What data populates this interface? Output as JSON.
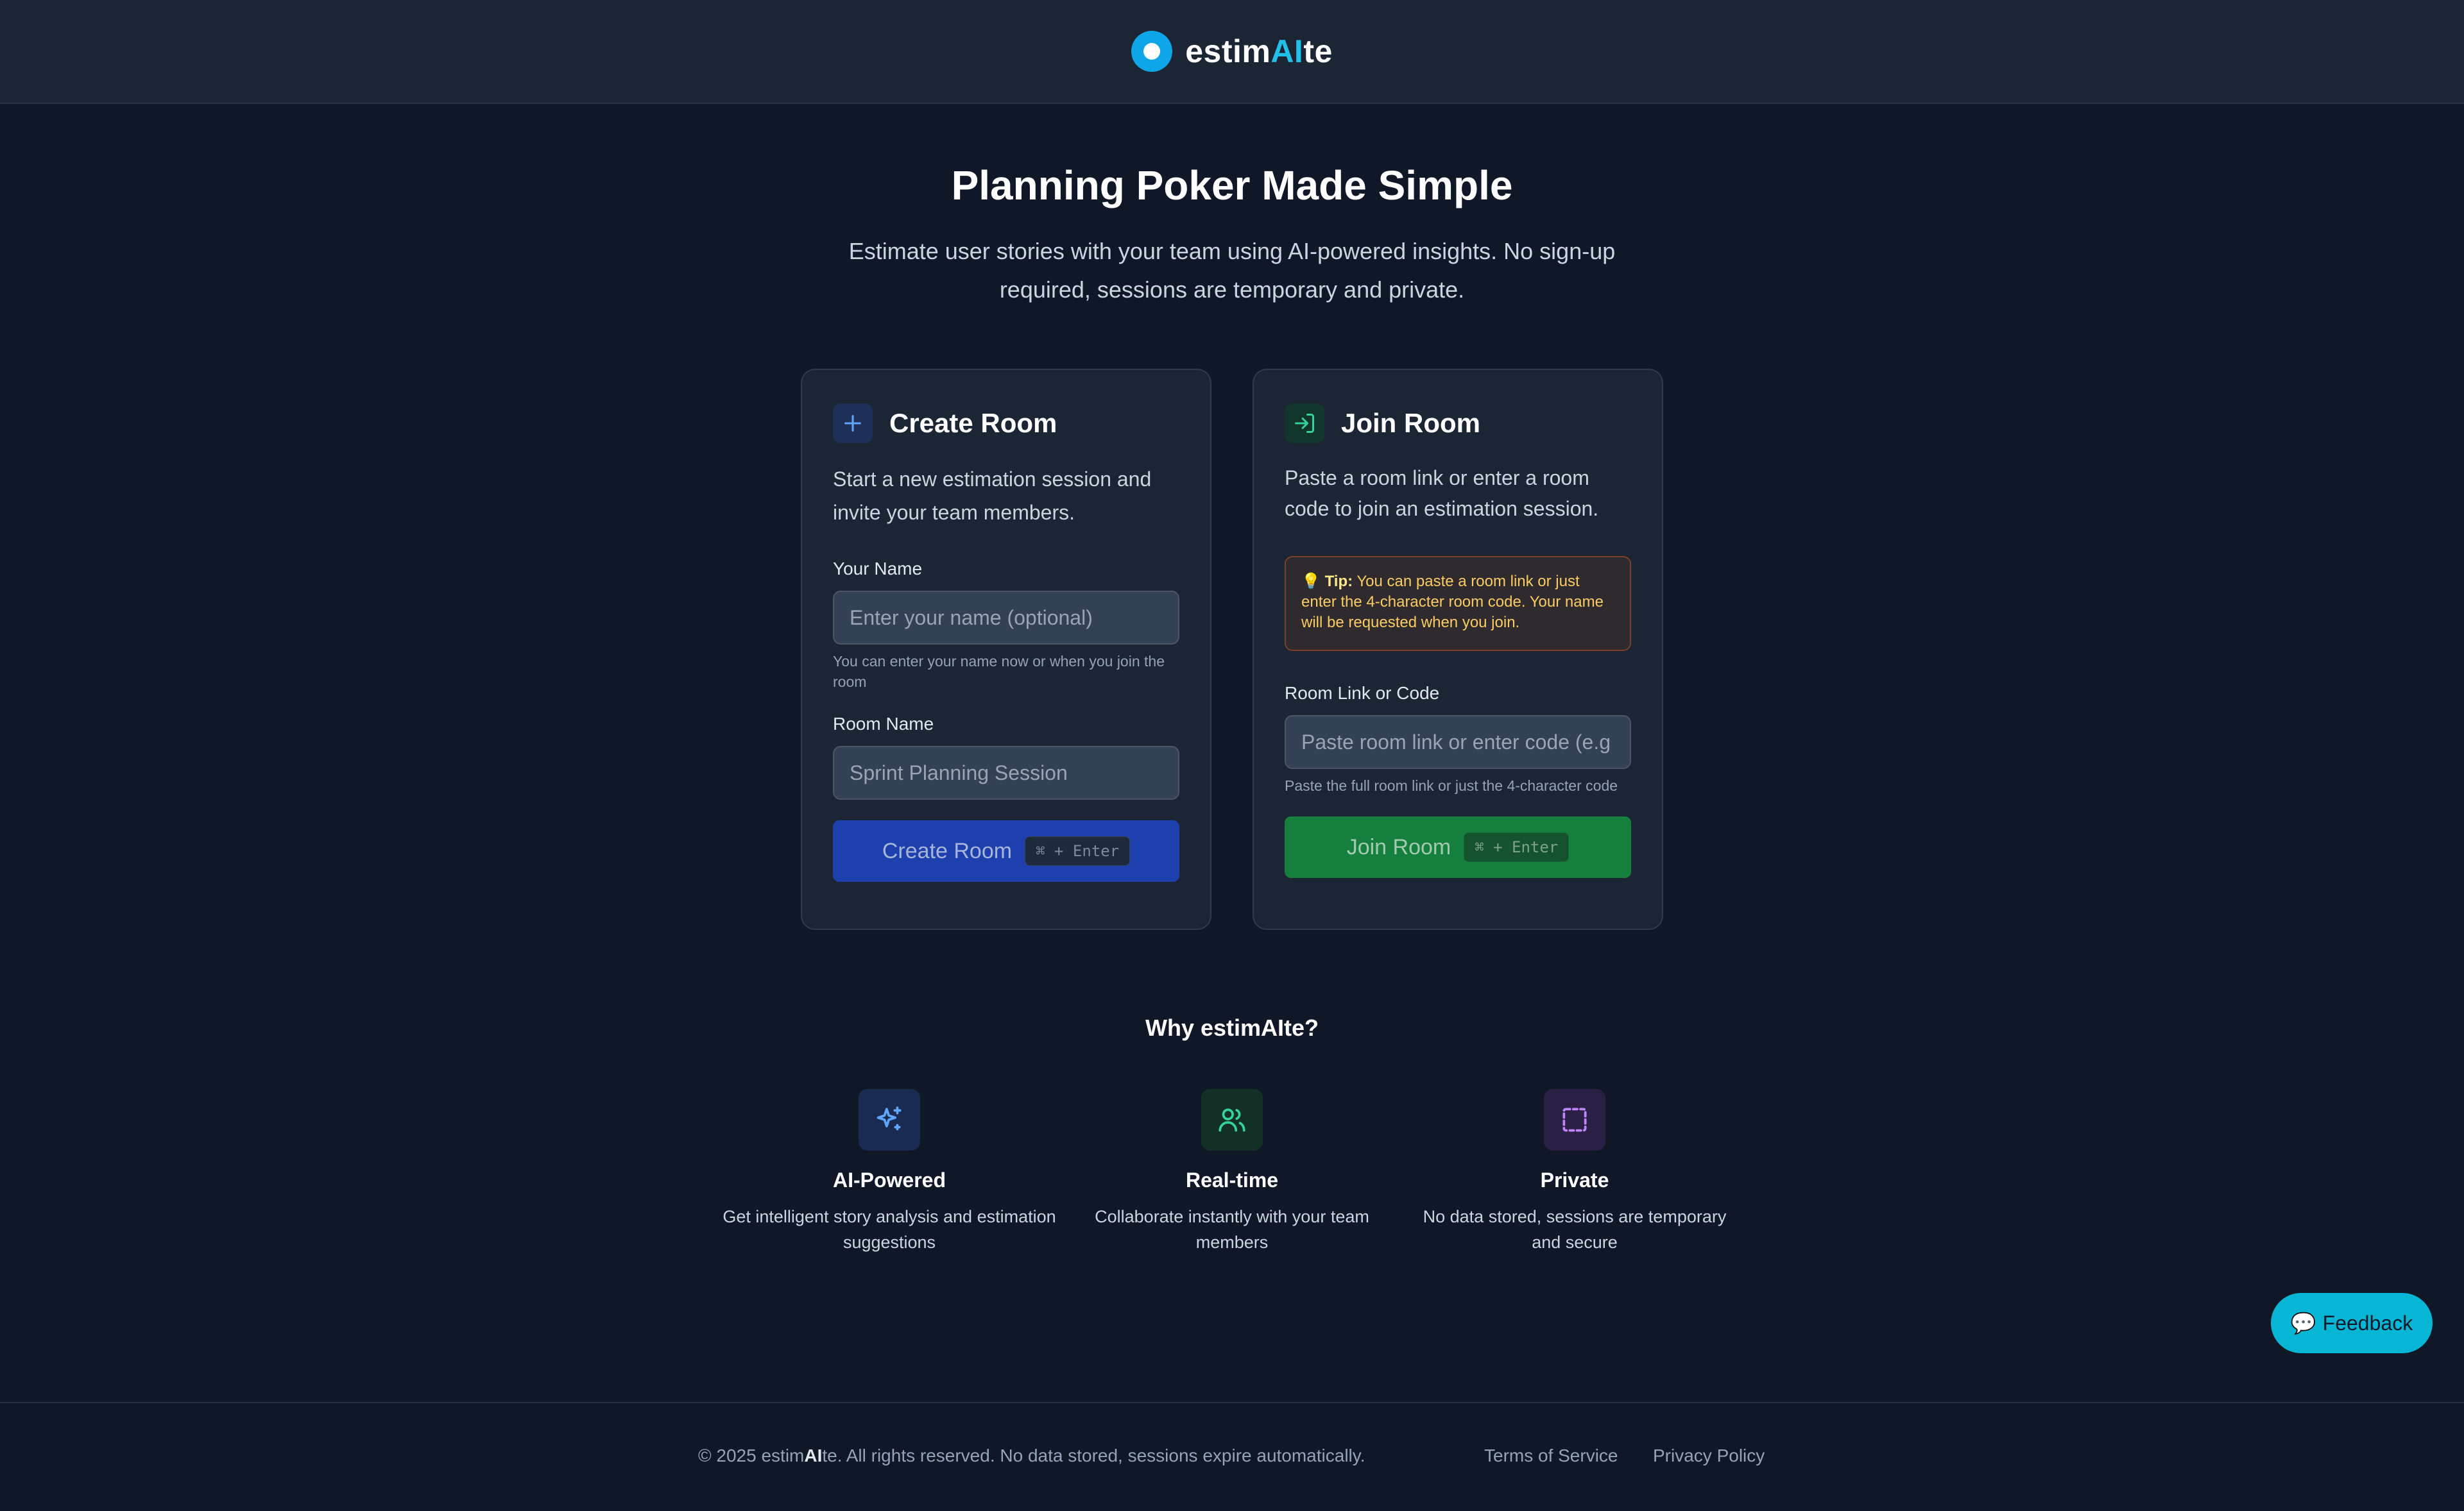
{
  "header": {
    "brand_prefix": "estim",
    "brand_accent": "AI",
    "brand_suffix": "te",
    "accent_color": "#22c0e8"
  },
  "hero": {
    "title": "Planning Poker Made Simple",
    "subtitle": "Estimate user stories with your team using AI-powered insights. No sign-up required, sessions are temporary and private."
  },
  "create_room": {
    "icon": "plus-icon",
    "title": "Create Room",
    "description": "Start a new estimation session and invite your team members.",
    "name_label": "Your Name",
    "name_value": "",
    "name_placeholder": "Enter your name (optional)",
    "name_hint": "You can enter your name now or when you join the room",
    "room_label": "Room Name",
    "room_value": "",
    "room_placeholder": "Sprint Planning Session",
    "button_label": "Create Room",
    "shortcut": "⌘ + Enter",
    "button_color": "#1e40af"
  },
  "join_room": {
    "icon": "enter-icon",
    "title": "Join Room",
    "description": "Paste a room link or enter a room code to join an estimation session.",
    "tip_prefix": "💡",
    "tip_label": "Tip:",
    "tip_text": "You can paste a room link or just enter the 4-character room code. Your name will be requested when you join.",
    "field_label": "Room Link or Code",
    "field_value": "",
    "field_placeholder": "Paste room link or enter code (e.g",
    "field_hint": "Paste the full room link or just the 4-character code",
    "button_label": "Join Room",
    "shortcut": "⌘ + Enter",
    "button_color": "#15803d"
  },
  "why": {
    "title": "Why estimAIte?",
    "features": [
      {
        "icon": "sparkles-icon",
        "title": "AI-Powered",
        "description": "Get intelligent story analysis and estimation suggestions"
      },
      {
        "icon": "users-icon",
        "title": "Real-time",
        "description": "Collaborate instantly with your team members"
      },
      {
        "icon": "dashed-square-icon",
        "title": "Private",
        "description": "No data stored, sessions are temporary and secure"
      }
    ]
  },
  "feedback": {
    "icon": "speech-bubble-icon",
    "glyph": "💬",
    "label": "Feedback"
  },
  "footer": {
    "copyright_prefix": "© 2025 estim",
    "copyright_bold": "AI",
    "copyright_suffix": "te. All rights reserved. No data stored, sessions expire automatically.",
    "terms_label": "Terms of Service",
    "privacy_label": "Privacy Policy"
  }
}
